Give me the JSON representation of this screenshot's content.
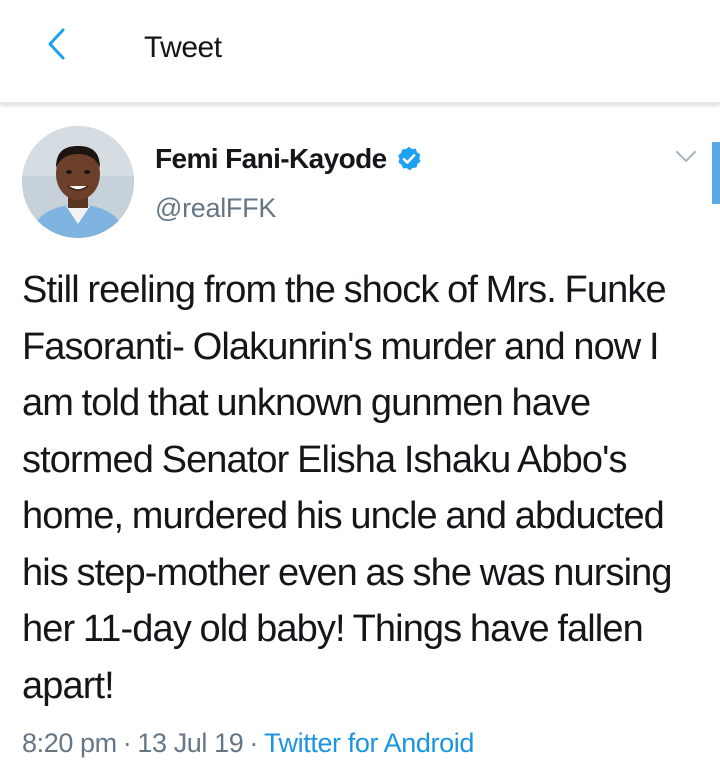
{
  "header": {
    "title": "Tweet",
    "back_icon": "chevron-left-icon"
  },
  "tweet": {
    "author_name": "Femi Fani-Kayode",
    "author_handle": "@realFFK",
    "verified_icon": "verified-badge-icon",
    "menu_icon": "chevron-down-icon",
    "text": "Still reeling from the shock of Mrs. Funke Fasoranti- Olakunrin's murder and now I am told that unknown gunmen have stormed Senator Elisha Ishaku Abbo's home, murdered his uncle and abducted his step-mother even as she was nursing her 11-day old baby! Things have fallen apart!",
    "time": "8:20 pm",
    "date": "13 Jul 19",
    "separator": "·",
    "source": "Twitter for Android"
  },
  "colors": {
    "accent": "#1da1f2",
    "link": "#1b95e0",
    "secondary_text": "#657786",
    "primary_text": "#14171a"
  }
}
